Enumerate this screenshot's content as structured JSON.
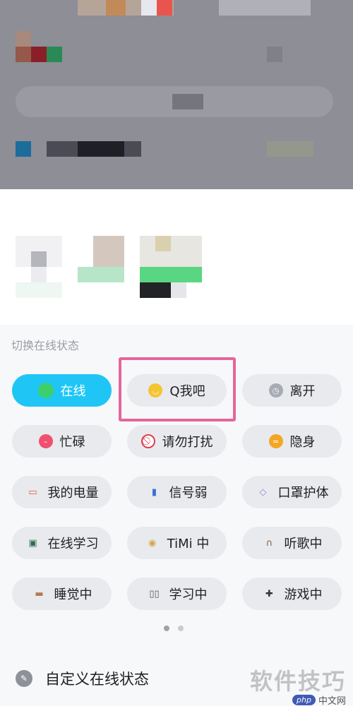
{
  "status_panel": {
    "title": "切换在线状态",
    "options": [
      {
        "label": "在线",
        "icon": "online-dot-icon",
        "color": "#3ccf6b",
        "active": true
      },
      {
        "label": "Q我吧",
        "icon": "smiley-icon",
        "color": "#f5c531",
        "active": false
      },
      {
        "label": "离开",
        "icon": "clock-icon",
        "color": "#a7abb3",
        "active": false
      },
      {
        "label": "忙碌",
        "icon": "busy-icon",
        "color": "#f0506e",
        "active": false
      },
      {
        "label": "请勿打扰",
        "icon": "no-disturb-icon",
        "color": "#e0404f",
        "active": false
      },
      {
        "label": "隐身",
        "icon": "invisible-icon",
        "color": "#f5a623",
        "active": false
      },
      {
        "label": "我的电量",
        "icon": "battery-icon",
        "color": "#e8553b",
        "active": false
      },
      {
        "label": "信号弱",
        "icon": "signal-icon",
        "color": "#3a6fd8",
        "active": false
      },
      {
        "label": "口罩护体",
        "icon": "mask-icon",
        "color": "#8a8fd8",
        "active": false
      },
      {
        "label": "在线学习",
        "icon": "computer-study-icon",
        "color": "#2e6b4a",
        "active": false
      },
      {
        "label": "TiMi 中",
        "icon": "timi-game-icon",
        "color": "#d7a54a",
        "active": false
      },
      {
        "label": "听歌中",
        "icon": "headphones-icon",
        "color": "#7c5a3c",
        "active": false
      },
      {
        "label": "睡觉中",
        "icon": "bed-icon",
        "color": "#b07a55",
        "active": false
      },
      {
        "label": "学习中",
        "icon": "book-icon",
        "color": "#555555",
        "active": false
      },
      {
        "label": "游戏中",
        "icon": "gamepad-icon",
        "color": "#333333",
        "active": false
      }
    ]
  },
  "pagination": {
    "pages": 2,
    "current": 1
  },
  "custom_status": {
    "label": "自定义在线状态",
    "icon": "pencil-icon"
  },
  "watermark": {
    "main": "软件技巧",
    "badge": "php",
    "site": "中文网"
  },
  "colors": {
    "accent": "#1fc6f5",
    "highlight_border": "#e4669a",
    "chip_bg": "#e9eaee"
  }
}
